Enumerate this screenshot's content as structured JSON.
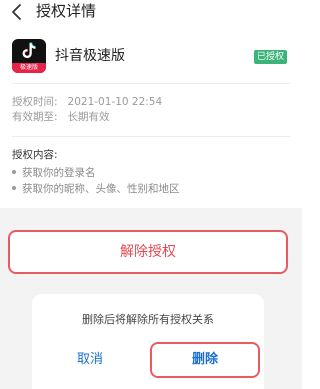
{
  "header": {
    "title": "授权详情",
    "back_icon": "chevron-left-icon"
  },
  "app": {
    "name": "抖音极速版",
    "logo_band_text": "极速版",
    "status_badge": "已授权",
    "badge_color": "#3cb37a"
  },
  "auth": {
    "time_label": "授权时间:",
    "time_value": "2021-01-10 22:54",
    "validity_label": "有效期至:",
    "validity_value": "长期有效"
  },
  "permissions": {
    "title": "授权内容:",
    "items": [
      "获取你的登录名",
      "获取你的昵称、头像、性别和地区"
    ]
  },
  "revoke_button": {
    "label": "解除授权",
    "color": "#e44a55"
  },
  "dialog": {
    "message": "删除后将解除所有授权关系",
    "cancel_label": "取消",
    "delete_label": "删除",
    "button_color": "#1a6fd0"
  },
  "colors": {
    "highlight_border": "#e85b62"
  }
}
